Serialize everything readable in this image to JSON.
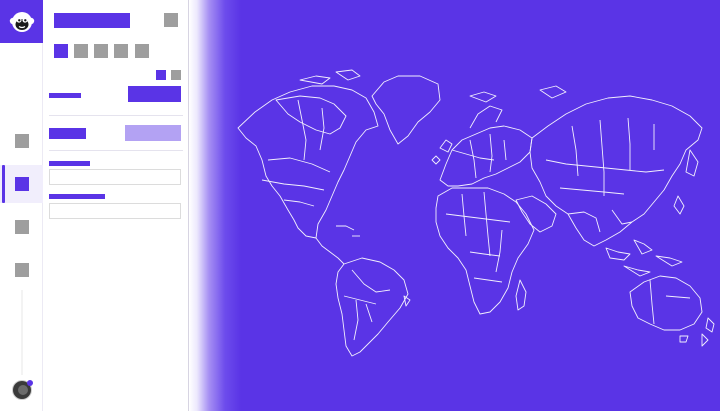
{
  "colors": {
    "accent": "#5a34e6",
    "accent_soft": "#b3a2f3",
    "placeholder_gray": "#9e9e9e",
    "map_stroke": "#ffffff"
  },
  "rail": {
    "brand_icon": "monkey-logo-icon",
    "items": [
      {
        "icon": "placeholder-square-icon",
        "active": false
      },
      {
        "icon": "placeholder-square-icon",
        "active": true
      },
      {
        "icon": "placeholder-square-icon",
        "active": false
      },
      {
        "icon": "placeholder-square-icon",
        "active": false
      }
    ],
    "avatar_icon": "user-avatar-icon"
  },
  "panel": {
    "toolbar_icons": [
      "primary-square-icon",
      "gray-square-icon",
      "gray-square-icon",
      "gray-square-icon",
      "gray-square-icon"
    ],
    "mini_icons": [
      "primary-square-icon",
      "gray-square-icon"
    ],
    "fields": [
      {
        "value": "",
        "placeholder": ""
      },
      {
        "value": "",
        "placeholder": ""
      }
    ]
  },
  "map": {
    "kind": "world-map-outline",
    "icon": "world-map-icon"
  }
}
